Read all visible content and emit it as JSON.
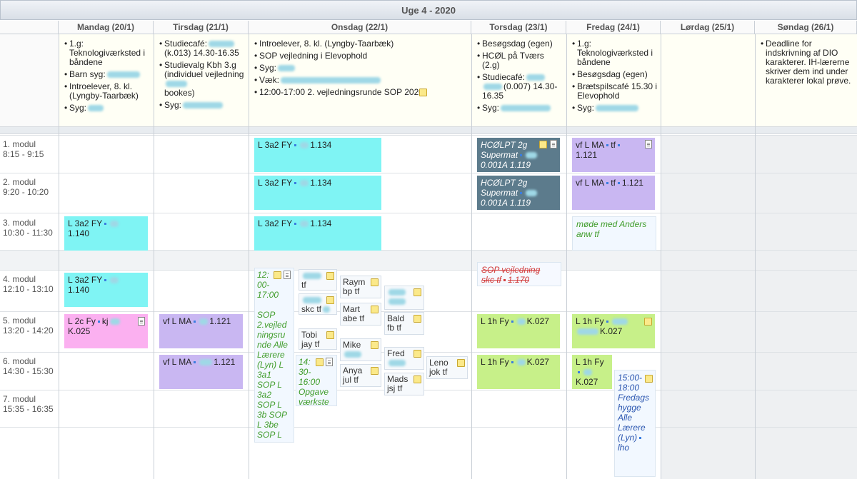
{
  "title": "Uge 4 - 2020",
  "days": [
    "Mandag (20/1)",
    "Tirsdag (21/1)",
    "Onsdag (22/1)",
    "Torsdag (23/1)",
    "Fredag (24/1)",
    "Lørdag (25/1)",
    "Søndag (26/1)"
  ],
  "allday": {
    "mon": [
      "1.g: Teknologiværksted i båndene",
      "Barn syg:",
      "Introelever, 8. kl. (Lyngby-Taarbæk)",
      "Syg:"
    ],
    "tue": [
      "Studiecafé:",
      "(k.013) 14.30-16.35",
      "Studievalg Kbh 3.g (individuel vejledning",
      "bookes)",
      "Syg:"
    ],
    "wed": [
      "Introelever, 8. kl. (Lyngby-Taarbæk)",
      "SOP vejledning i Elevophold",
      "Syg:",
      "Væk:",
      "12:00-17:00 2. vejledningsrunde SOP 2020"
    ],
    "thu": [
      "Besøgsdag (egen)",
      "HCØL på Tværs (2.g)",
      "Studiecafé:",
      "(0.007) 14.30-16.35",
      "Syg:"
    ],
    "fri": [
      "1.g: Teknologiværksted i båndene",
      "Besøgsdag (egen)",
      "Brætspilscafé 15.30 i Elevophold",
      "Syg:"
    ],
    "sun": [
      "Deadline for indskrivning af DIO karakterer. IH-lærerne skriver dem ind under karakterer lokal prøve."
    ]
  },
  "modules": [
    {
      "name": "1. modul",
      "time": "8:15 - 9:15"
    },
    {
      "name": "2. modul",
      "time": "9:20 - 10:20"
    },
    {
      "name": "3. modul",
      "time": "10:30 - 11:30"
    },
    {
      "name": "4. modul",
      "time": "12:10 - 13:10"
    },
    {
      "name": "5. modul",
      "time": "13:20 - 14:20"
    },
    {
      "name": "6. modul",
      "time": "14:30 - 15:30"
    },
    {
      "name": "7. modul",
      "time": "15:35 - 16:35"
    }
  ],
  "events": {
    "mon3a": "L 3a2 FY",
    "mon3b": "1.140",
    "mon4a": "L 3a2 FY",
    "mon4b": "1.140",
    "mon5a": "L 2c Fy",
    "mon5a2": "kj",
    "mon5b": "K.025",
    "tue5": "vf L MA",
    "tue5r": "1.121",
    "tue6": "vf L MA",
    "tue6r": "1.121",
    "wed1": "L 3a2 FY",
    "wed1r": "1.134",
    "wed2": "L 3a2 FY",
    "wed2r": "1.134",
    "wed3": "L 3a2 FY",
    "wed3r": "1.134",
    "wedA1": "12:",
    "wedA2": "00-",
    "wedA3": "17:00",
    "wedA4": "SOP 2.vejled ningsru nde Alle Lærere (Lyn) L 3a1 SOP L 3a2 SOP L 3b SOP L 3be SOP L",
    "wedB1": "14:",
    "wedB2": "30-",
    "wedB3": "16:00",
    "wedB4": "Opgave værkste",
    "wedS1": "tf",
    "wedS2": "skc tf",
    "wedS3": "Tobi",
    "wedS4": "jay tf",
    "wedS5": "Raym",
    "wedS6": "bp tf",
    "wedS7": "Mart",
    "wedS8": "abe tf",
    "wedS9": "Mike",
    "wedS10": "Anya",
    "wedS11": "jul tf",
    "wedS12": "Bald",
    "wedS13": "fb tf",
    "wedS14": "Fred",
    "wedS15": "Mads",
    "wedS16": "jsj tf",
    "wedS17": "Leno",
    "wedS18": "jok tf",
    "thu1a": "HCØLPT 2g",
    "thu1b": "Supermat",
    "thu1c": "0.001A 1.119",
    "thu2a": "HCØLPT 2g",
    "thu2b": "Supermat",
    "thu2c": "0.001A 1.119",
    "thu4a": "SOP vejledning",
    "thu4b": "skc tf",
    "thu4c": "1.170",
    "thu5": "L 1h Fy",
    "thu5r": "K.027",
    "thu6": "L 1h Fy",
    "thu6r": "K.027",
    "fri1a": "vf L MA",
    "fri1tf": "tf",
    "fri1b": "1.121",
    "fri2": "vf L MA",
    "fri2tf": "tf",
    "fri2r": "1.121",
    "fri3a": "møde med Anders",
    "fri3b": "anw tf",
    "fri5": "L 1h Fy",
    "fri5r": "K.027",
    "fri6a": "L 1h Fy",
    "fri6r": "K.027",
    "friH1": "15:00-",
    "friH2": "18:00",
    "friH3": "Fredags hygge Alle Lærere (Lyn)",
    "friH4": "lho"
  }
}
